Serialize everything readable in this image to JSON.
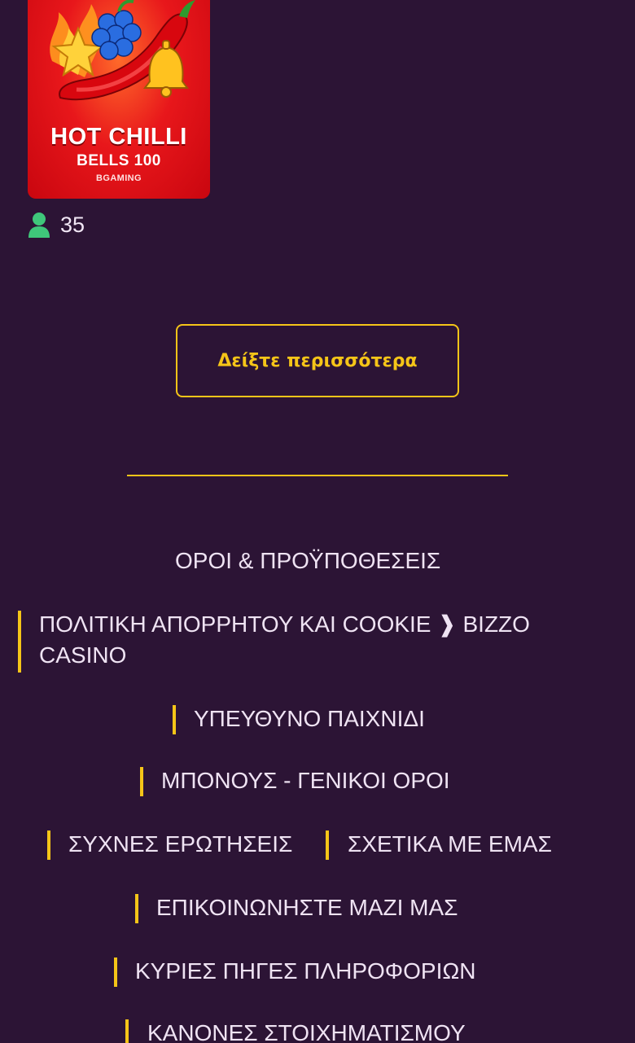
{
  "game": {
    "title_line1": "HOT CHILLI",
    "title_line2": "BELLS 100",
    "provider": "BGAMING",
    "players_count": "35",
    "icons": {
      "players": "user-icon"
    },
    "colors": {
      "tile": "#e8171b",
      "players_icon": "#3fc77a"
    }
  },
  "show_more_label": "Δείξτε περισσότερα",
  "footer": {
    "links": {
      "terms": "ΟΡΟΙ & ΠΡΟΫΠΟΘΕΣΕΙΣ",
      "privacy_line1": "ΠΟΛΙΤΙΚΗ ΑΠΟΡΡΗΤΟΥ ΚΑΙ COOKIE ❱ BIZZO",
      "privacy_line2": "CASINO",
      "responsible": "ΥΠΕΥΘΥΝΟ ΠΑΙΧΝΙΔΙ",
      "bonus": "ΜΠΟΝΟΥΣ - ΓΕΝΙΚΟΙ ΟΡΟΙ",
      "faq": "ΣΥΧΝΕΣ ΕΡΩΤΗΣΕΙΣ",
      "about": "ΣΧΕΤΙΚΑ ΜΕ ΕΜΑΣ",
      "contact": "ΕΠΙΚΟΙΝΩΝΗΣΤΕ ΜΑΖΙ ΜΑΣ",
      "sources": "ΚΥΡΙΕΣ ΠΗΓΕΣ ΠΛΗΡΟΦΟΡΙΩΝ",
      "betting": "ΚΑΝΟΝΕΣ ΣΤΟΙΧΗΜΑΤΙΣΜΟΥ"
    }
  },
  "colors": {
    "background": "#2c1435",
    "accent": "#f5c518",
    "text": "#efe3f3"
  }
}
